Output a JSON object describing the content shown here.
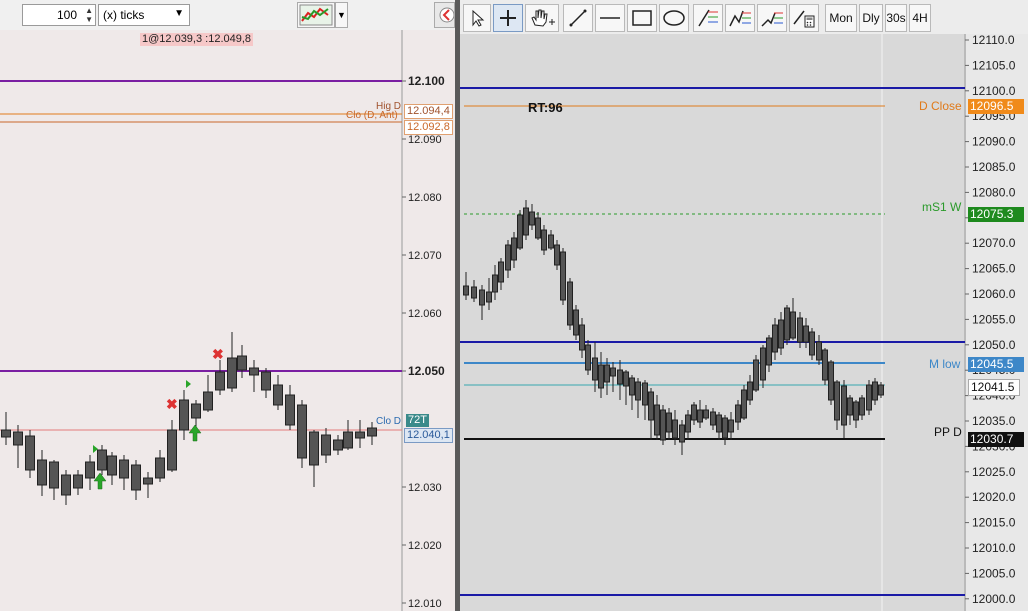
{
  "left": {
    "quantity": "100",
    "interval": "(x) ticks",
    "order_info": "1@12.039,3 :12.049,8",
    "axis_labels": [
      "12.100",
      "12.090",
      "12.080",
      "12.070",
      "12.060",
      "12.050",
      "12.030",
      "12.020",
      "12.010"
    ],
    "level_labels": {
      "high_d": "Hig D",
      "high_d_value": "12.094,4",
      "close_prev": "Clo (D, Ant)",
      "close_prev_value": "12.092,8",
      "close_d": "Clo D",
      "tick_badge": "72T",
      "last_value": "12.040,1"
    }
  },
  "right": {
    "toolbar": {
      "mon": "Mon",
      "dly": "Dly",
      "s30": "30s",
      "h4": "4H"
    },
    "rt_label": "RT:96",
    "axis_labels": [
      "12110.0",
      "12105.0",
      "12100.0",
      "12095.0",
      "12090.0",
      "12085.0",
      "12080.0",
      "12075.0",
      "12070.0",
      "12065.0",
      "12060.0",
      "12055.0",
      "12050.0",
      "12045.0",
      "12040.0",
      "12035.0",
      "12030.0",
      "12025.0",
      "12020.0",
      "12015.0",
      "12010.0",
      "12005.0",
      "12000.0"
    ],
    "levels": {
      "d_close": "D Close",
      "d_close_value": "12096.5",
      "ms1w": "mS1 W",
      "ms1w_value": "12075.3",
      "m_low": "M low",
      "m_low_value": "12045.5",
      "last_value": "12041.5",
      "pp_d": "PP D",
      "pp_d_value": "12030.7"
    }
  },
  "colors": {
    "purple_line": "#7a1fa2",
    "navy_line": "#1a1aa6",
    "orange_line": "#e07a1a",
    "green_line": "#2a9a2a",
    "steel_blue": "#3d87c8",
    "teal_line": "#38a6b0",
    "red_line": "#e37a7a"
  }
}
